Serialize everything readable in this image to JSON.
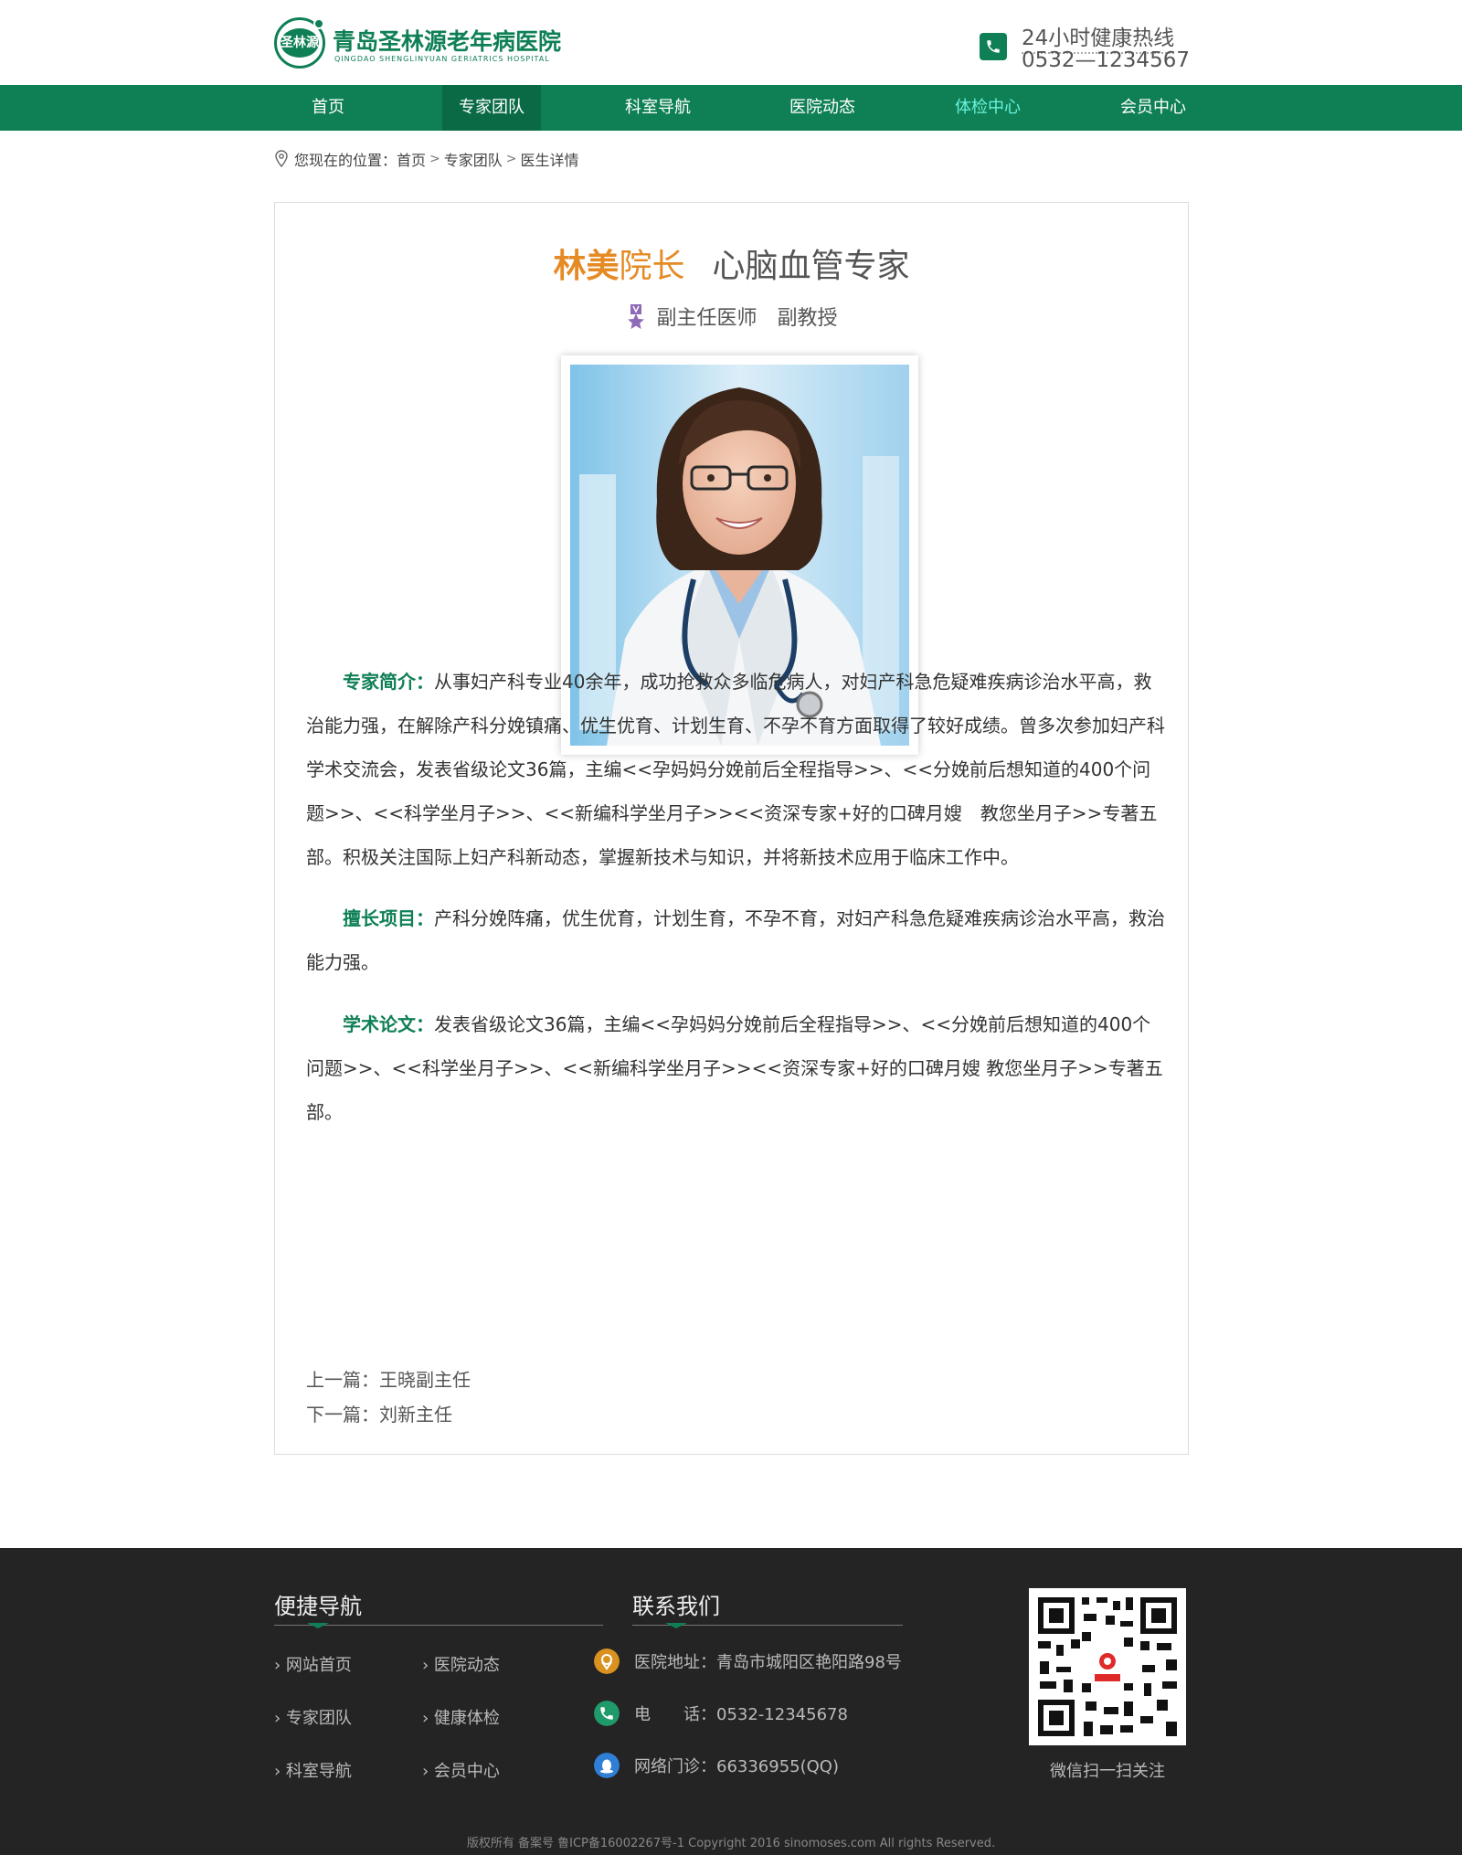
{
  "header": {
    "hospital_name": "青岛圣林源老年病医院",
    "hospital_name_en": "QINGDAO SHENGLINYUAN GERIATRICS HOSPITAL",
    "logo_text": "圣林源",
    "hotline_label": "24小时健康热线",
    "hotline_number": "0532—1234567",
    "brand_color": "#0f8055"
  },
  "nav": {
    "items": [
      {
        "label": "首页"
      },
      {
        "label": "专家团队"
      },
      {
        "label": "科室导航"
      },
      {
        "label": "医院动态"
      },
      {
        "label": "体检中心"
      },
      {
        "label": "会员中心"
      }
    ],
    "active_index": 1,
    "highlight_index": 4
  },
  "breadcrumb": {
    "prefix": "您现在的位置：",
    "items": [
      "首页",
      "专家团队",
      "医生详情"
    ]
  },
  "doctor": {
    "name": "林美",
    "role": "院长",
    "specialty": "心脑血管专家",
    "title1": "副主任医师",
    "title2": "副教授",
    "sections": [
      {
        "label": "专家简介：",
        "text": "从事妇产科专业40余年，成功抢救众多临危病人，对妇产科急危疑难疾病诊治水平高，救治能力强，在解除产科分娩镇痛、优生优育、计划生育、不孕不育方面取得了较好成绩。曾多次参加妇产科学术交流会，发表省级论文36篇，主编<<孕妈妈分娩前后全程指导>>、<<分娩前后想知道的400个问题>>、<<科学坐月子>>、<<新编科学坐月子>><<资深专家+好的口碑月嫂　教您坐月子>>专著五部。积极关注国际上妇产科新动态，掌握新技术与知识，并将新技术应用于临床工作中。"
      },
      {
        "label": "擅长项目：",
        "text": "产科分娩阵痛，优生优育，计划生育，不孕不育，对妇产科急危疑难疾病诊治水平高，救治能力强。"
      },
      {
        "label": "学术论文：",
        "text": "发表省级论文36篇，主编<<孕妈妈分娩前后全程指导>>、<<分娩前后想知道的400个问题>>、<<科学坐月子>>、<<新编科学坐月子>><<资深专家+好的口碑月嫂 教您坐月子>>专著五部。"
      }
    ],
    "prev": "上一篇：王晓副主任",
    "next": "下一篇：刘新主任",
    "accent_color": "#e58a24"
  },
  "footer": {
    "quick_nav_title": "便捷导航",
    "contact_title": "联系我们",
    "links_col1": [
      "网站首页",
      "专家团队",
      "科室导航"
    ],
    "links_col2": [
      "医院动态",
      "健康体检",
      "会员中心"
    ],
    "address": "医院地址：青岛市城阳区艳阳路98号",
    "phone": "电　　话：0532-12345678",
    "qq": "网络门诊：66336955(QQ)",
    "qr_caption": "微信扫一扫关注",
    "copyright": "版权所有 备案号 鲁ICP备16002267号-1 Copyright 2016 sinomoses.com All rights Reserved."
  }
}
